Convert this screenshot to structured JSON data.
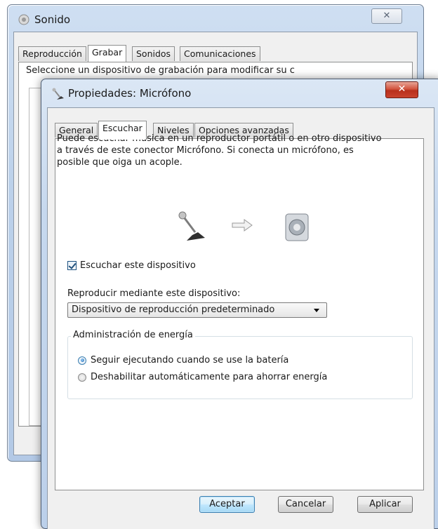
{
  "back_window": {
    "title": "Sonido",
    "close_glyph": "✕",
    "tabs": [
      "Reproducción",
      "Grabar",
      "Sonidos",
      "Comunicaciones"
    ],
    "active_tab": 1,
    "description_fragment": "Seleccione un dispositivo de grabación para modificar su c"
  },
  "dialog": {
    "title": "Propiedades: Micrófono",
    "close_glyph": "✕",
    "tabs": [
      "General",
      "Escuchar",
      "Niveles",
      "Opciones avanzadas"
    ],
    "active_tab": 1,
    "description": "Puede escuchar música en un reproductor portátil o en otro dispositivo a través de este conector Micrófono. Si conecta un micrófono, es posible que oiga un acople.",
    "illustration": {
      "source_icon": "microphone-icon",
      "arrow_icon": "arrow-right-icon",
      "target_icon": "speaker-icon"
    },
    "listen_checkbox": {
      "label": "Escuchar este dispositivo",
      "checked": true
    },
    "playback_label": "Reproducir mediante este dispositivo:",
    "playback_select": {
      "value": "Dispositivo de reproducción predeterminado"
    },
    "power_group": {
      "title": "Administración de energía",
      "options": [
        {
          "label": "Seguir ejecutando cuando se use la batería",
          "selected": true
        },
        {
          "label": "Deshabilitar automáticamente para ahorrar energía",
          "selected": false
        }
      ]
    },
    "buttons": {
      "ok": "Aceptar",
      "cancel": "Cancelar",
      "apply": "Aplicar"
    }
  },
  "colors": {
    "accent": "#3c7fb1",
    "close_red": "#c9432d",
    "frame": "#bcd0ea"
  }
}
